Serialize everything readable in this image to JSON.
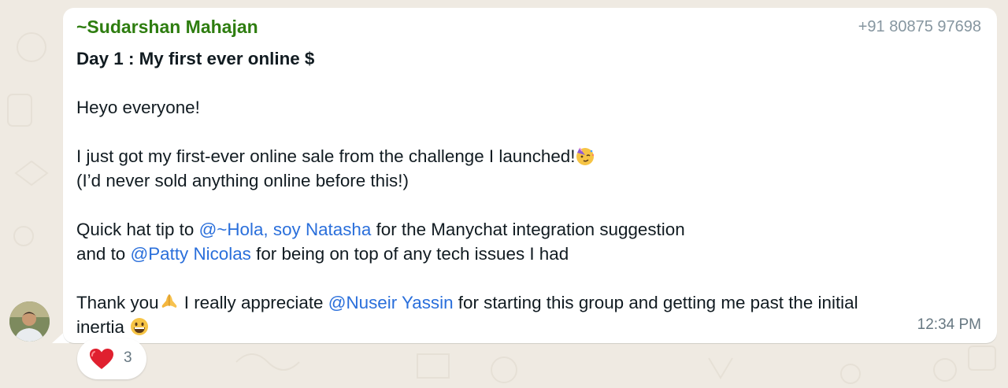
{
  "message": {
    "sender_name": "~Sudarshan Mahajan",
    "sender_phone": "+91 80875 97698",
    "title": "Day 1 : My first ever online $",
    "greeting": "Heyo everyone!",
    "line_sale": "I just got my first-ever online sale from the challenge I launched!",
    "line_never": "(I’d never sold anything online before this!)",
    "hat_tip_prefix": "Quick hat tip to ",
    "mention_natasha": "@~Hola, soy Natasha",
    "hat_tip_suffix": " for the Manychat integration suggestion",
    "and_to_prefix": "and to ",
    "mention_patty": "@Patty Nicolas",
    "and_to_suffix": " for being on top of any tech issues I had",
    "thanks_prefix": "Thank you",
    "thanks_middle": " I really appreciate ",
    "mention_nuseir": "@Nuseir Yassin",
    "thanks_suffix": " for starting this group and getting me past the initial",
    "inertia": "inertia ",
    "timestamp": "12:34 PM"
  },
  "reaction": {
    "icon": "heart-icon",
    "count": "3"
  },
  "colors": {
    "sender_name": "#2e7d10",
    "mention": "#2a6fdb",
    "background": "#efeae2",
    "bubble": "#ffffff"
  }
}
